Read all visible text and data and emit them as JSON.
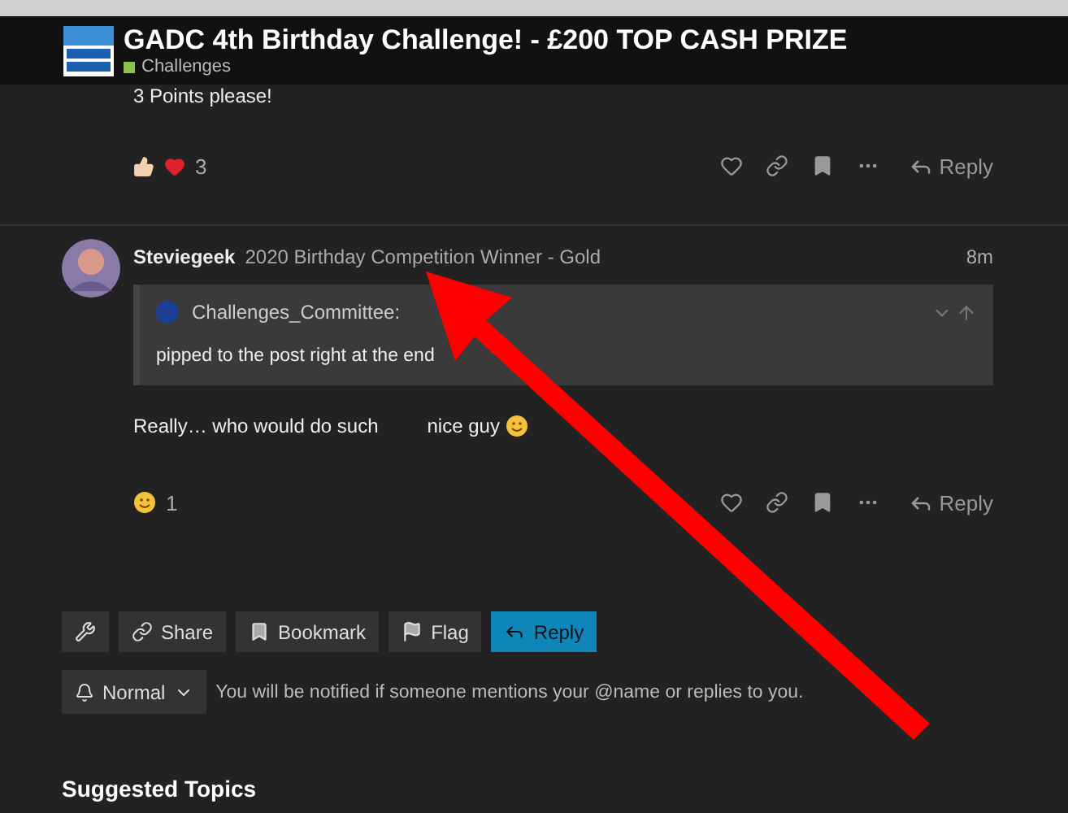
{
  "header": {
    "title": "GADC 4th Birthday Challenge! - £200 TOP CASH PRIZE",
    "category": {
      "name": "Challenges",
      "color": "#8bc34a"
    }
  },
  "posts": [
    {
      "kind": "tail",
      "body": "3 Points please!",
      "reaction_count": "3",
      "reply_label": "Reply"
    },
    {
      "kind": "full",
      "author": "Steviegeek",
      "badge": "2020 Birthday Competition Winner - Gold",
      "time": "8m",
      "quote": {
        "author": "Challenges_Committee:",
        "text": "pipped to the post right at the end"
      },
      "body": "Really… who would do such",
      "body_after": "nice guy",
      "reaction_count": "1",
      "reply_label": "Reply"
    }
  ],
  "footer_buttons": [
    {
      "kind": "admin"
    },
    {
      "kind": "share",
      "label": "Share"
    },
    {
      "kind": "bookmark",
      "label": "Bookmark"
    },
    {
      "kind": "flag",
      "label": "Flag"
    },
    {
      "kind": "reply",
      "label": "Reply"
    }
  ],
  "notifications": {
    "level": "Normal",
    "description": "You will be notified if someone mentions your @name or replies to you."
  },
  "suggested": {
    "heading": "Suggested Topics"
  }
}
